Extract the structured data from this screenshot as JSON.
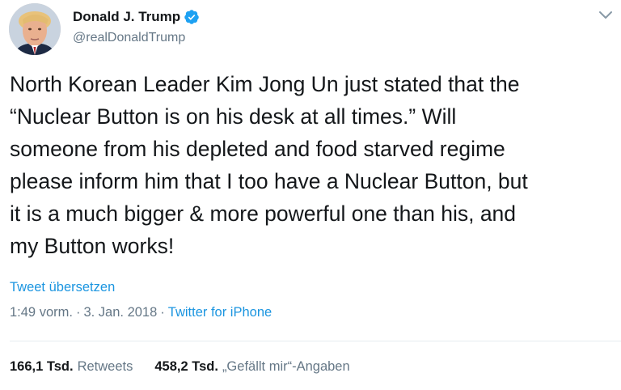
{
  "author": {
    "display_name": "Donald J. Trump",
    "handle": "@realDonaldTrump",
    "verified_icon": "verified-badge-icon",
    "avatar_icon": "profile-photo"
  },
  "menu_icon": "chevron-down-icon",
  "tweet": {
    "text": "North Korean Leader Kim Jong Un just stated that the\n“Nuclear Button is on his desk at all times.” Will\nsomeone from his depleted and food starved regime\nplease inform him that I too have a Nuclear Button, but\nit is a much bigger & more powerful one than his, and\nmy Button works!",
    "translate_label": "Tweet übersetzen"
  },
  "meta": {
    "time": "1:49 vorm.",
    "sep1": "·",
    "date": "3. Jan. 2018",
    "sep2": "·",
    "source": "Twitter for iPhone"
  },
  "stats": {
    "retweets_count": "166,1 Tsd.",
    "retweets_label": "Retweets",
    "likes_count": "458,2 Tsd.",
    "likes_label": "„Gefällt mir“-Angaben"
  },
  "colors": {
    "link": "#1b95e0",
    "secondary_text": "#657786",
    "primary_text": "#14171a",
    "divider": "#e6ecf0"
  }
}
